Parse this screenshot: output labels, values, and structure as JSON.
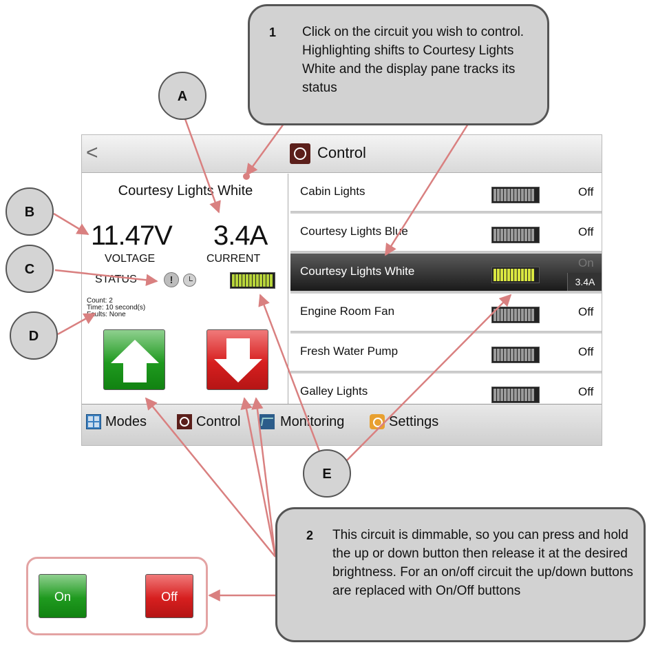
{
  "header": {
    "back_glyph": "<",
    "title": "Control"
  },
  "detail": {
    "circuit_name": "Courtesy Lights White",
    "voltage": "11.47V",
    "current": "3.4A",
    "voltage_label": "VOLTAGE",
    "current_label": "CURRENT",
    "status_label": "STATUS",
    "alert_glyph": "!",
    "count_line": "Count: 2",
    "time_line": "Time: 10 second(s)",
    "faults_line": "Faults:    None"
  },
  "circuits": [
    {
      "name": "Cabin Lights",
      "state": "Off"
    },
    {
      "name": "Courtesy Lights Blue",
      "state": "Off"
    },
    {
      "name": "Courtesy Lights White",
      "state": "On",
      "amps": "3.4A",
      "selected": true
    },
    {
      "name": "Engine Room Fan",
      "state": "Off"
    },
    {
      "name": "Fresh Water Pump",
      "state": "Off"
    },
    {
      "name": "Galley Lights",
      "state": "Off"
    }
  ],
  "nav": {
    "modes": "Modes",
    "control": "Control",
    "monitoring": "Monitoring",
    "settings": "Settings"
  },
  "callouts": {
    "a": "A",
    "b": "B",
    "c": "C",
    "d": "D",
    "e": "E",
    "note1_num": "1",
    "note1_text": "Click on the circuit you wish to control. Highlighting shifts to Courtesy Lights White and the display pane tracks its status",
    "note2_num": "2",
    "note2_text": "This circuit is dimmable, so you can press and hold the up or down button then release it at the desired brightness. For an on/off circuit the up/down buttons are replaced with On/Off buttons"
  },
  "legend": {
    "on_label": "On",
    "off_label": "Off"
  },
  "colors": {
    "arrow": "#d98080",
    "selected_row": "#2a2a2a",
    "meter_on": "#c9dc3a",
    "up_green": "#1f9a1f",
    "down_red": "#d71f1f"
  }
}
